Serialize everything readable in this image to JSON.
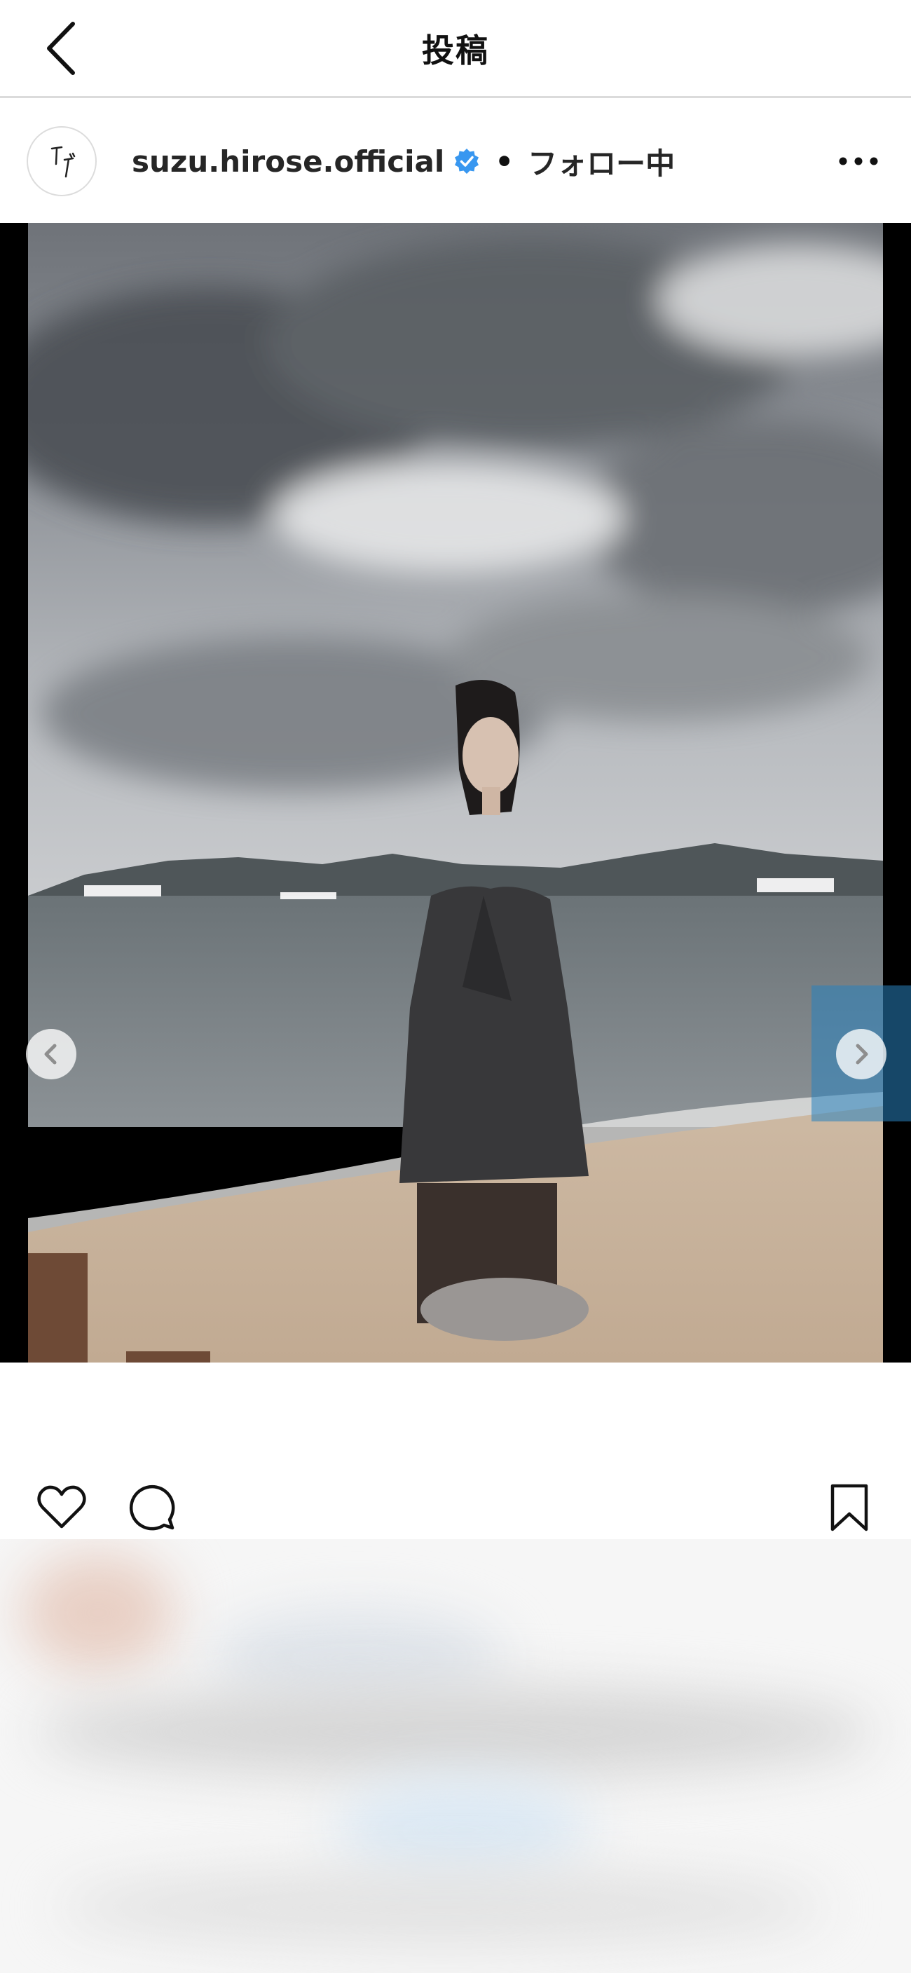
{
  "header": {
    "title": "投稿"
  },
  "post": {
    "username": "suzu.hirose.official",
    "separator": "•",
    "follow_state": "フォロー中",
    "avatar_icon": "signature-logo",
    "verified_icon": "verified-badge-icon"
  },
  "media": {
    "scene": "beach-photo",
    "mute_icon": "speaker-muted-icon",
    "prev_icon": "chevron-left-icon",
    "next_icon": "chevron-right-icon"
  },
  "actions": {
    "like_icon": "heart-icon",
    "comment_icon": "comment-bubble-icon",
    "save_icon": "bookmark-icon"
  },
  "colors": {
    "verified_blue": "#3897f0",
    "divider": "#dbdbdb",
    "text": "#262626"
  }
}
